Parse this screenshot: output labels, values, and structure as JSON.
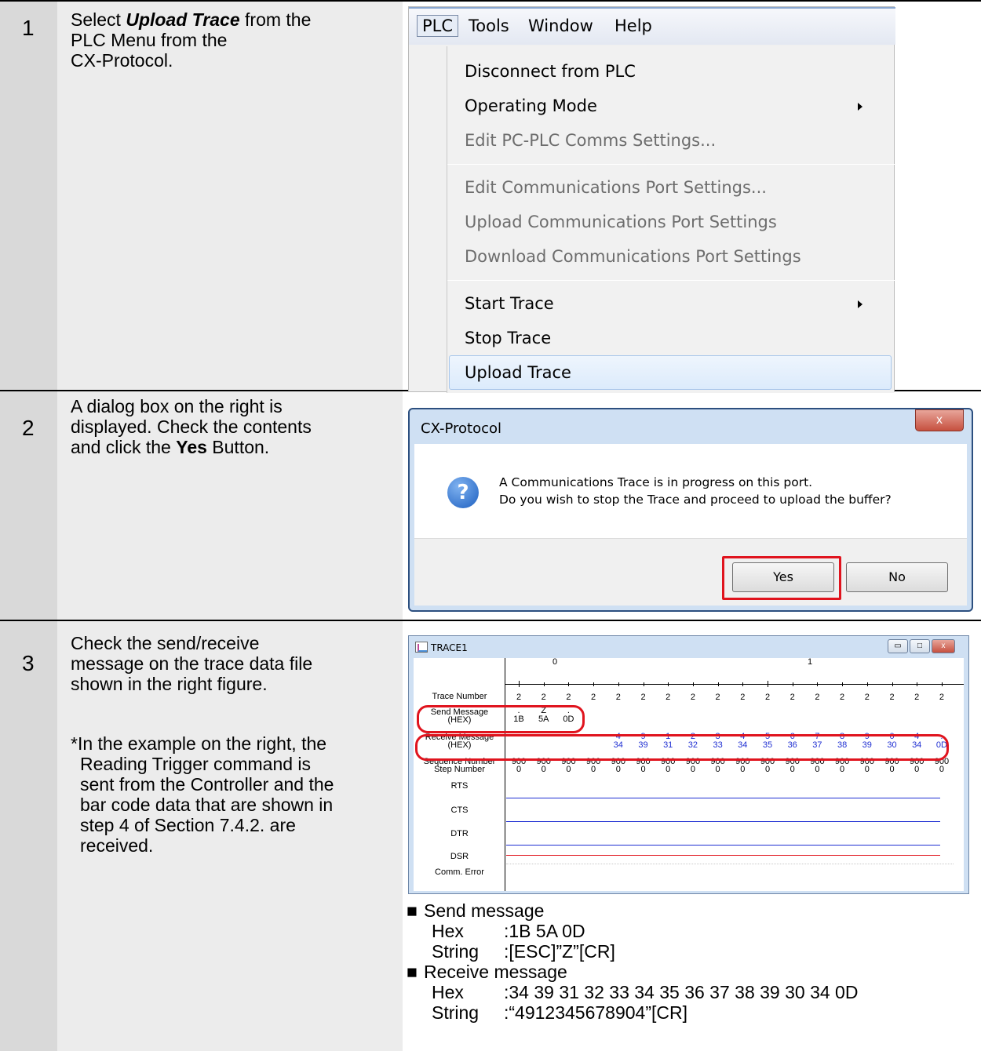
{
  "steps": [
    {
      "number": "1",
      "lines": [
        {
          "pre": "Select ",
          "emph": "Upload Trace",
          "post": " from the"
        },
        {
          "text": "PLC Menu from the"
        },
        {
          "text": "CX-Protocol."
        }
      ]
    },
    {
      "number": "2",
      "lines": [
        {
          "text": "A dialog box on the right is"
        },
        {
          "text": "displayed. Check the contents"
        },
        {
          "pre": "and click the ",
          "bold": "Yes",
          "post": " Button."
        }
      ]
    },
    {
      "number": "3",
      "lines": [
        {
          "text": "Check the send/receive"
        },
        {
          "text": "message on the trace data file"
        },
        {
          "text": "shown in the right figure."
        }
      ],
      "note_lines": [
        "*In the example on the right, the",
        "Reading Trigger command is",
        "sent from the Controller and the",
        "bar code data that are shown in",
        "step 4 of Section 7.4.2. are",
        "received."
      ]
    }
  ],
  "plc_menu": {
    "menubar": [
      "PLC",
      "Tools",
      "Window",
      "Help"
    ],
    "items": [
      {
        "label": "Disconnect from PLC",
        "enabled": true,
        "submenu": false
      },
      {
        "label": "Operating Mode",
        "enabled": true,
        "submenu": true
      },
      {
        "label": "Edit PC-PLC Comms Settings...",
        "enabled": false,
        "submenu": false
      },
      {
        "label": "Edit Communications Port Settings...",
        "enabled": false,
        "submenu": false
      },
      {
        "label": "Upload Communications Port Settings",
        "enabled": false,
        "submenu": false
      },
      {
        "label": "Download Communications Port Settings",
        "enabled": false,
        "submenu": false
      },
      {
        "label": "Start Trace",
        "enabled": true,
        "submenu": true
      },
      {
        "label": "Stop Trace",
        "enabled": true,
        "submenu": false
      },
      {
        "label": "Upload Trace",
        "enabled": true,
        "submenu": false,
        "highlighted": true
      }
    ]
  },
  "dialog": {
    "title": "CX-Protocol",
    "close_glyph": "x",
    "icon_glyph": "?",
    "message_line1": "A Communications Trace is in progress on this port.",
    "message_line2": "Do you wish to stop the Trace and proceed to upload the buffer?",
    "yes_label": "Yes",
    "no_label": "No"
  },
  "trace_window": {
    "title": "TRACE1",
    "buttons": {
      "minimize": "▭",
      "maximize": "□",
      "close": "x"
    },
    "row_labels": {
      "trace_number": "Trace Number",
      "send_message": [
        "Send Message",
        "(HEX)"
      ],
      "receive_message": [
        "Receive Message",
        "(HEX)"
      ],
      "sequence_step": [
        "Sequence Number",
        "Step Number"
      ],
      "rts": "RTS",
      "cts": "CTS",
      "dtr": "DTR",
      "dsr": "DSR",
      "comm_error": "Comm. Error"
    },
    "axis_labels": [
      "0",
      "1"
    ],
    "trace_numbers": [
      "2",
      "2",
      "2",
      "2",
      "2",
      "2",
      "2",
      "2",
      "2",
      "2",
      "2",
      "2",
      "2",
      "2",
      "2",
      "2",
      "2",
      "2"
    ],
    "send_chars": [
      ".",
      "Z",
      "."
    ],
    "send_hex": [
      "1B",
      "5A",
      "0D"
    ],
    "receive_chars": [
      "4",
      "9",
      "1",
      "2",
      "3",
      "4",
      "5",
      "6",
      "7",
      "8",
      "9",
      "0",
      "4",
      "."
    ],
    "receive_hex": [
      "34",
      "39",
      "31",
      "32",
      "33",
      "34",
      "35",
      "36",
      "37",
      "38",
      "39",
      "30",
      "34",
      "0D"
    ],
    "sequence_numbers": [
      "900",
      "900",
      "900",
      "900",
      "900",
      "900",
      "900",
      "900",
      "900",
      "900",
      "900",
      "900",
      "900",
      "900",
      "900",
      "900",
      "900",
      "900"
    ],
    "step_numbers": [
      "0",
      "0",
      "0",
      "0",
      "0",
      "0",
      "0",
      "0",
      "0",
      "0",
      "0",
      "0",
      "0",
      "0",
      "0",
      "0",
      "0",
      "0"
    ],
    "colors": {
      "signal_blue": "#1f2fd2",
      "signal_red": "#e0141e",
      "highlight": "#e0141e"
    }
  },
  "messages": {
    "send": {
      "bullet": "■",
      "heading": "Send message",
      "hex_key": "Hex",
      "hex_value": ":1B 5A 0D",
      "string_key": "String",
      "string_value": ":[ESC]”Z”[CR]"
    },
    "receive": {
      "bullet": "■",
      "heading": "Receive message",
      "hex_key": "Hex",
      "hex_value": ":34 39 31 32 33 34 35 36 37 38 39 30 34 0D",
      "string_key": "String",
      "string_value": ":“4912345678904”[CR]"
    }
  }
}
